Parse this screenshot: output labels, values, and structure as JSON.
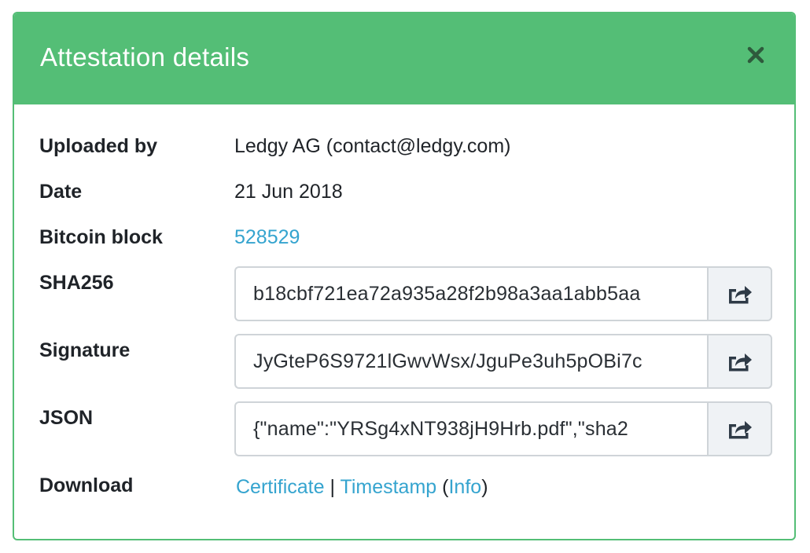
{
  "modal": {
    "title": "Attestation details"
  },
  "details": {
    "uploaded_by_label": "Uploaded by",
    "uploaded_by_value": "Ledgy AG (contact@ledgy.com)",
    "date_label": "Date",
    "date_value": "21 Jun 2018",
    "bitcoin_block_label": "Bitcoin block",
    "bitcoin_block_value": "528529",
    "sha256_label": "SHA256",
    "sha256_value": "b18cbf721ea72a935a28f2b98a3aa1abb5aa",
    "signature_label": "Signature",
    "signature_value": "JyGteP6S9721lGwvWsx/JguPe3uh5pOBi7c",
    "json_label": "JSON",
    "json_value": "{\"name\":\"YRSg4xNT938jH9Hrb.pdf\",\"sha2",
    "download_label": "Download",
    "download_certificate": "Certificate",
    "download_separator": " | ",
    "download_timestamp": "Timestamp",
    "download_open_paren": " (",
    "download_info": "Info",
    "download_close_paren": ")"
  },
  "colors": {
    "header_bg": "#54be76",
    "link": "#35a4cf",
    "button_bg": "#eff2f5"
  },
  "icons": {
    "close": "close-icon",
    "share": "share-icon"
  }
}
